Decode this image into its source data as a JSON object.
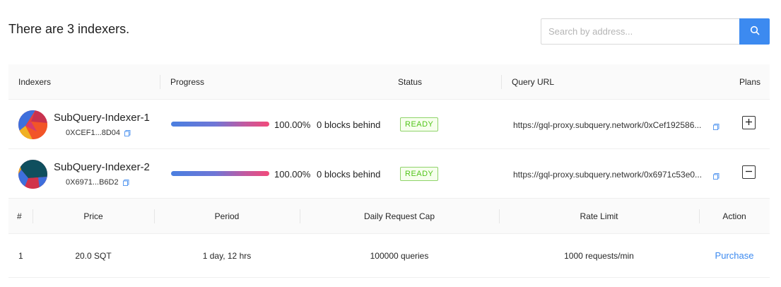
{
  "heading": "There are 3 indexers.",
  "search": {
    "placeholder": "Search by address...",
    "icon": "search-icon"
  },
  "table": {
    "columns": [
      "Indexers",
      "Progress",
      "Status",
      "Query URL",
      "Plans"
    ],
    "rows": [
      {
        "name": "SubQuery-Indexer-1",
        "address": "0XCEF1...8D04",
        "progress_fraction": 1.0,
        "progress_label": "100.00%",
        "blocks_behind": "0 blocks behind",
        "status": "READY",
        "query_url": "https://gql-proxy.subquery.network/0xCef192586...",
        "plans_toggle": "expand"
      },
      {
        "name": "SubQuery-Indexer-2",
        "address": "0X6971...B6D2",
        "progress_fraction": 1.0,
        "progress_label": "100.00%",
        "blocks_behind": "0 blocks behind",
        "status": "READY",
        "query_url": "https://gql-proxy.subquery.network/0x6971c53e0...",
        "plans_toggle": "collapse"
      }
    ]
  },
  "plans": {
    "columns": [
      "#",
      "Price",
      "Period",
      "Daily Request Cap",
      "Rate Limit",
      "Action"
    ],
    "rows": [
      {
        "index": "1",
        "price": "20.0 SQT",
        "period": "1 day, 12 hrs",
        "daily_cap": "100000 queries",
        "rate_limit": "1000 requests/min",
        "action": "Purchase"
      }
    ]
  },
  "colors": {
    "accent": "#3c8af0",
    "ready": "#52c41a"
  }
}
